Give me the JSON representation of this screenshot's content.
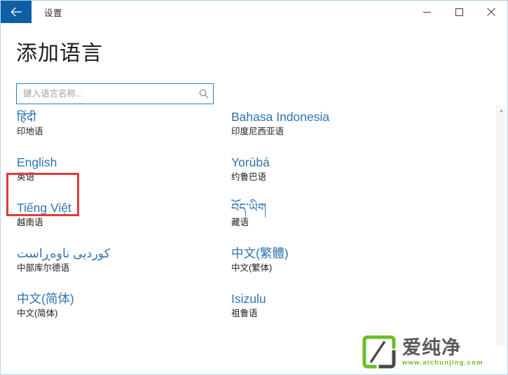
{
  "titlebar": {
    "back_icon": "back-arrow-icon",
    "app_title": "设置",
    "minimize_label": "–",
    "maximize_label": "☐",
    "close_label": "✕"
  },
  "header": {
    "page_title": "添加语言"
  },
  "search": {
    "value": "",
    "placeholder": "键入语言名称...",
    "icon": "search-icon"
  },
  "list": {
    "clipped_top": [
      {
        "native": "",
        "translated": ""
      },
      {
        "native": "",
        "translated": ""
      }
    ],
    "items": [
      {
        "native": "हिंदी",
        "translated": "印地语",
        "rtl": false,
        "highlighted": false
      },
      {
        "native": "Bahasa Indonesia",
        "translated": "印度尼西亚语",
        "rtl": false,
        "highlighted": false
      },
      {
        "native": "English",
        "translated": "英语",
        "rtl": false,
        "highlighted": true
      },
      {
        "native": "Yorùbá",
        "translated": "约鲁巴语",
        "rtl": false,
        "highlighted": false
      },
      {
        "native": "Tiếng Việt",
        "translated": "越南语",
        "rtl": false,
        "highlighted": false
      },
      {
        "native": "བོད་ཡིག",
        "translated": "藏语",
        "rtl": false,
        "highlighted": false
      },
      {
        "native": "كوردیی ناوەڕاست",
        "translated": "中部库尔德语",
        "rtl": true,
        "highlighted": false
      },
      {
        "native": "中文(繁體)",
        "translated": "中文(繁体)",
        "rtl": false,
        "highlighted": false
      },
      {
        "native": "中文(简体)",
        "translated": "中文(简体)",
        "rtl": false,
        "highlighted": false
      },
      {
        "native": "Isizulu",
        "translated": "祖鲁语",
        "rtl": false,
        "highlighted": false
      }
    ]
  },
  "scrollbar": {
    "up_arrow": "▲"
  },
  "watermark": {
    "brand": "爱纯净",
    "url": "www.aichunjing.com"
  },
  "colors": {
    "accent_blue": "#2f74b5",
    "titlebar_back": "#0e5ea5",
    "highlight_red": "#e03b3b",
    "watermark_green": "#6cbd2a",
    "search_border": "#2a7fc3"
  }
}
